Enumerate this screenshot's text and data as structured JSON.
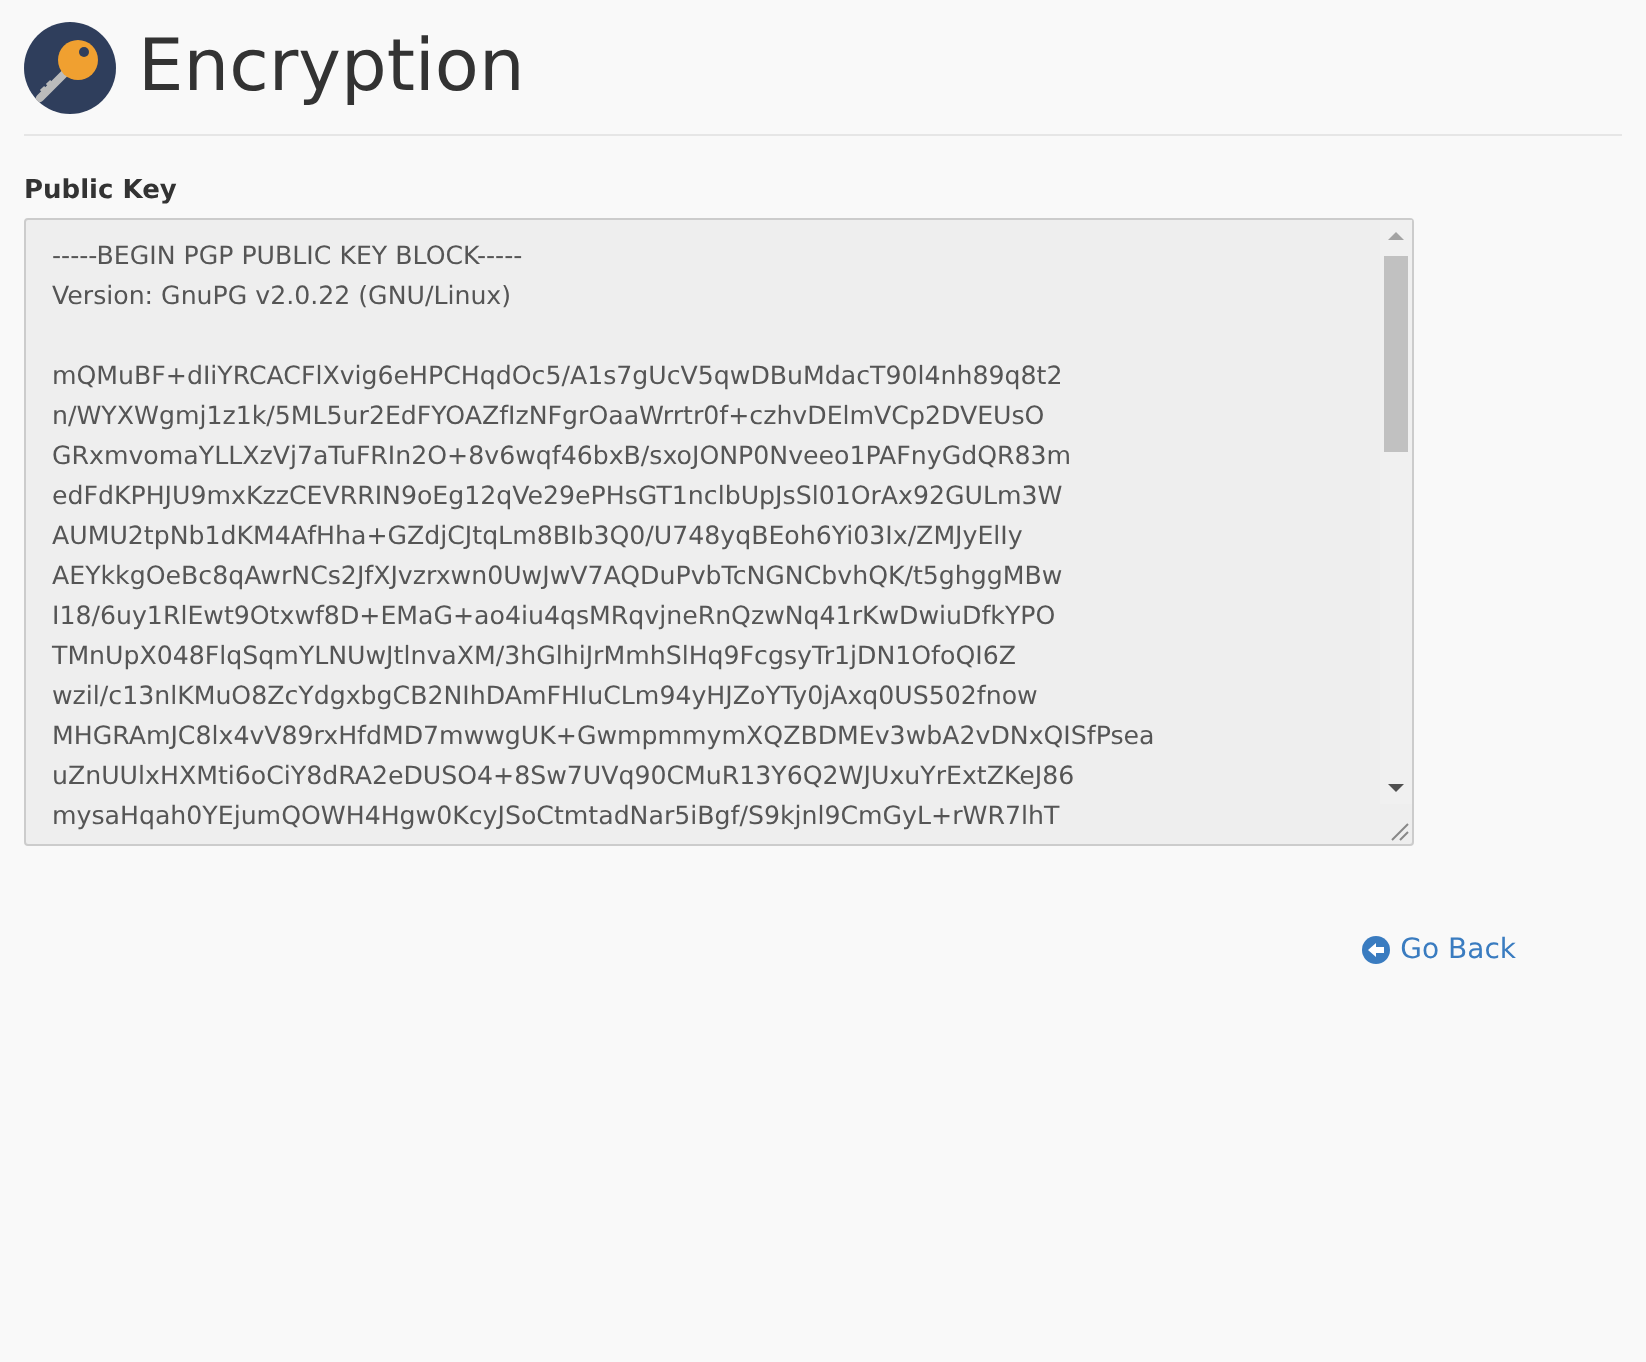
{
  "header": {
    "title": "Encryption"
  },
  "public_key": {
    "label": "Public Key",
    "value": "-----BEGIN PGP PUBLIC KEY BLOCK-----\nVersion: GnuPG v2.0.22 (GNU/Linux)\n\nmQMuBF+dIiYRCACFlXvig6eHPCHqdOc5/A1s7gUcV5qwDBuMdacT90l4nh89q8t2\nn/WYXWgmj1z1k/5ML5ur2EdFYOAZfIzNFgrOaaWrrtr0f+czhvDElmVCp2DVEUsO\nGRxmvomaYLLXzVj7aTuFRIn2O+8v6wqf46bxB/sxoJONP0Nveeo1PAFnyGdQR83m\nedFdKPHJU9mxKzzCEVRRIN9oEg12qVe29ePHsGT1nclbUpJsSl01OrAx92GULm3W\nAUMU2tpNb1dKM4AfHha+GZdjCJtqLm8BIb3Q0/U748yqBEoh6Yi03Ix/ZMJyElIy\nAEYkkgOeBc8qAwrNCs2JfXJvzrxwn0UwJwV7AQDuPvbTcNGNCbvhQK/t5ghggMBw\nI18/6uy1RlEwt9Otxwf8D+EMaG+ao4iu4qsMRqvjneRnQzwNq41rKwDwiuDfkYPO\nTMnUpX048FlqSqmYLNUwJtlnvaXM/3hGlhiJrMmhSlHq9FcgsyTr1jDN1OfoQI6Z\nwzil/c13nlKMuO8ZcYdgxbgCB2NIhDAmFHIuCLm94yHJZoYTy0jAxq0US502fnow\nMHGRAmJC8lx4vV89rxHfdMD7mwwgUK+GwmpmmymXQZBDMEv3wbA2vDNxQISfPsea\nuZnUUlxHXMti6oCiY8dRA2eDUSO4+8Sw7UVq90CMuR13Y6Q2WJUxuYrExtZKeJ86\nmysaHqah0YEjumQOWH4Hgw0KcyJSoCtmtadNar5iBgf/S9kjnl9CmGyL+rWR7lhT"
  },
  "links": [
    {
      "label": "Go Back"
    }
  ]
}
